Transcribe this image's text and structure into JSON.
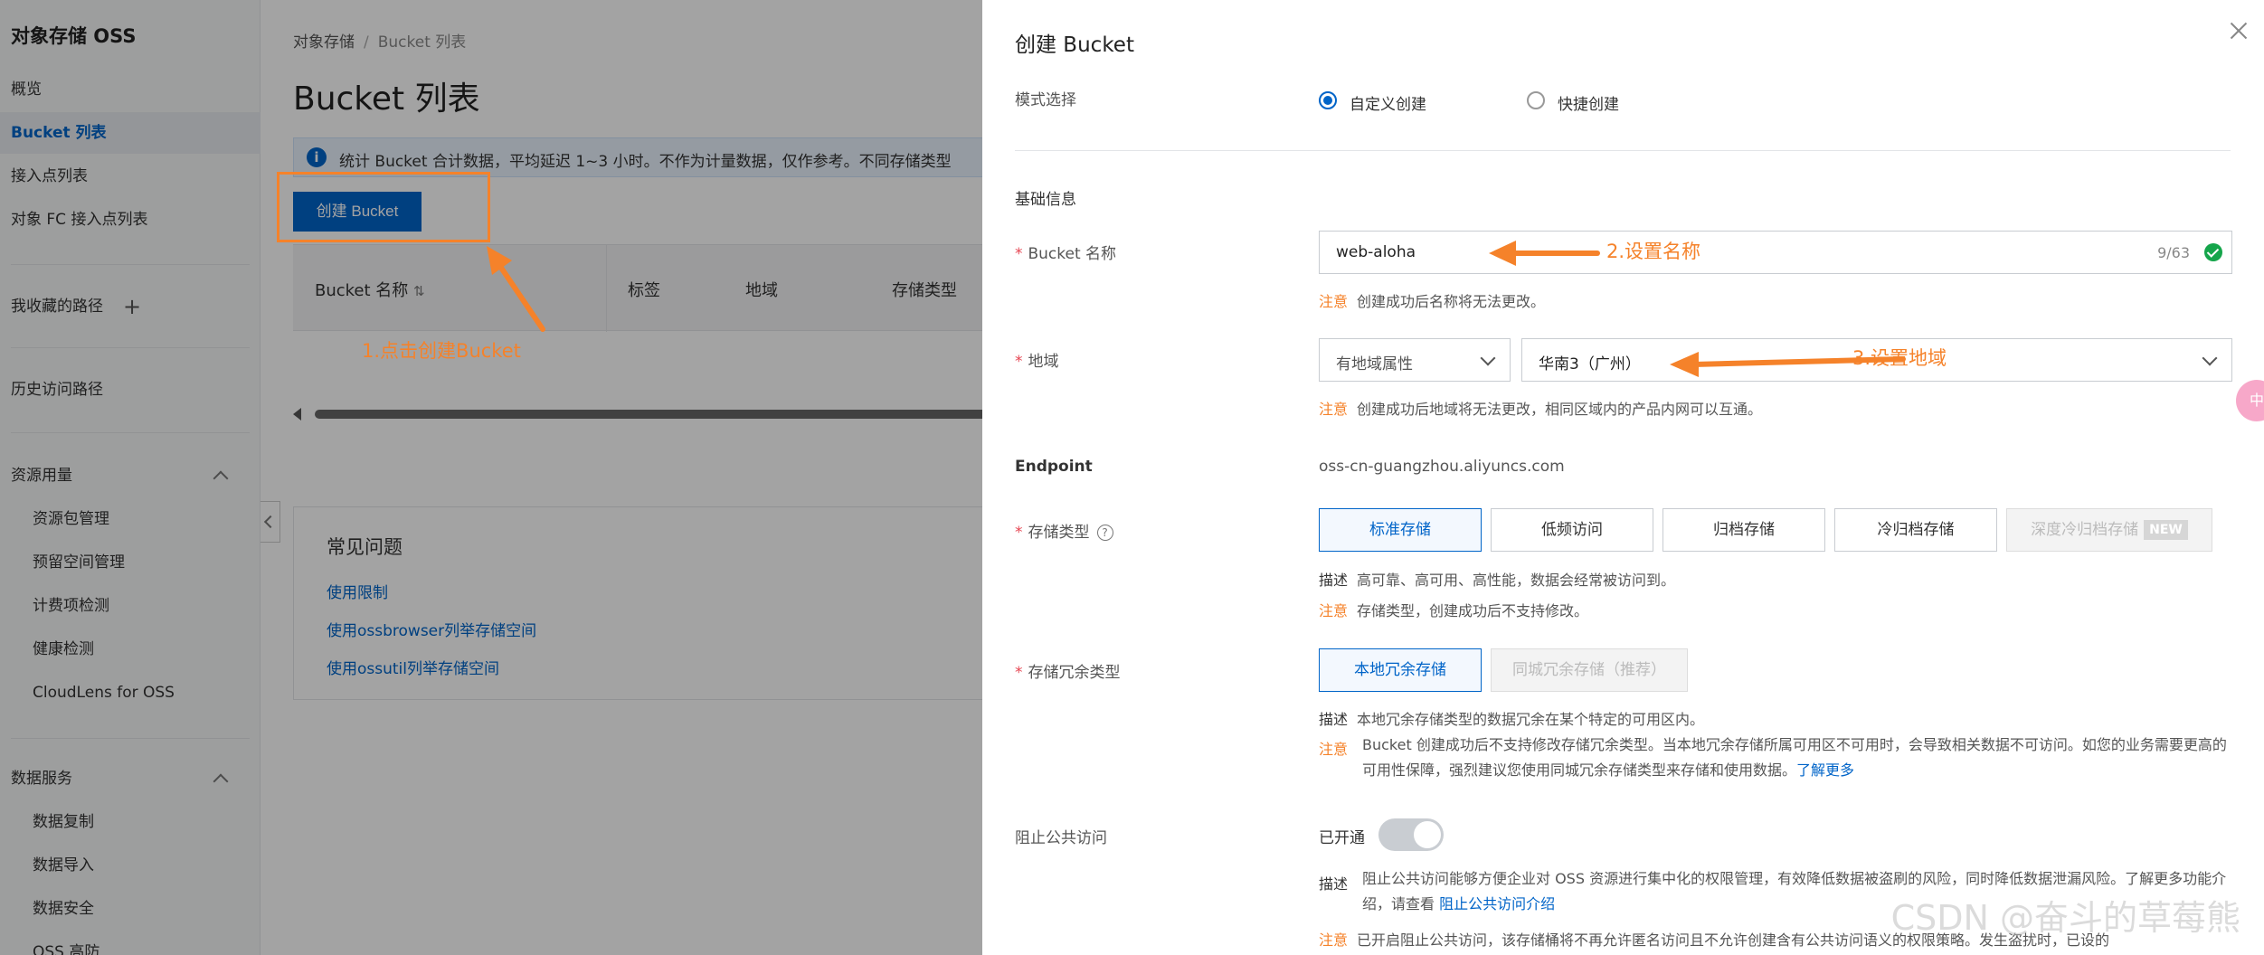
{
  "sidebar": {
    "title": "对象存储 OSS",
    "items": [
      {
        "label": "概览"
      },
      {
        "label": "Bucket 列表"
      },
      {
        "label": "接入点列表"
      },
      {
        "label": "对象 FC 接入点列表"
      }
    ],
    "favorites_label": "我收藏的路径",
    "history_label": "历史访问路径",
    "resource_group": {
      "label": "资源用量",
      "items": [
        "资源包管理",
        "预留空间管理",
        "计费项检测",
        "健康检测",
        "CloudLens for OSS"
      ]
    },
    "data_group": {
      "label": "数据服务",
      "items": [
        "数据复制",
        "数据导入",
        "数据安全",
        "OSS 高防"
      ]
    }
  },
  "main": {
    "breadcrumb": [
      "对象存储",
      "Bucket 列表"
    ],
    "title": "Bucket 列表",
    "info": "统计 Bucket 合计数据，平均延迟 1~3 小时。不作为计量数据，仅作参考。不同存储类型",
    "info_icon": "i",
    "create_button": "创建 Bucket",
    "table_headers": [
      "Bucket 名称",
      "标签",
      "地域",
      "存储类型"
    ],
    "faq": {
      "title": "常见问题",
      "links": [
        "使用限制",
        "使用ossbrowser列举存储空间",
        "使用ossutil列举存储空间"
      ]
    }
  },
  "annotations": {
    "step1": "1.点击创建Bucket",
    "step2": "2.设置名称",
    "step3": "3.设置地域",
    "color": "#f5822a"
  },
  "drawer": {
    "title": "创建 Bucket",
    "mode": {
      "label": "模式选择",
      "options": [
        "自定义创建",
        "快捷创建"
      ],
      "selected": "自定义创建"
    },
    "section_basic": "基础信息",
    "bucket_name": {
      "label": "Bucket 名称",
      "value": "web-aloha",
      "count": "9/63",
      "note_tag": "注意",
      "note": "创建成功后名称将无法更改。"
    },
    "region": {
      "label": "地域",
      "attr_value": "有地域属性",
      "value": "华南3（广州）",
      "note_tag": "注意",
      "note": "创建成功后地域将无法更改，相同区域内的产品内网可以互通。"
    },
    "endpoint": {
      "label": "Endpoint",
      "value": "oss-cn-guangzhou.aliyuncs.com"
    },
    "storage_class": {
      "label": "存储类型",
      "help_icon": "?",
      "options": [
        "标准存储",
        "低频访问",
        "归档存储",
        "冷归档存储",
        "深度冷归档存储"
      ],
      "new_badge": "NEW",
      "selected": "标准存储",
      "desc_tag": "描述",
      "desc": "高可靠、高可用、高性能，数据会经常被访问到。",
      "note_tag": "注意",
      "note": "存储类型，创建成功后不支持修改。"
    },
    "redundancy": {
      "label": "存储冗余类型",
      "options": [
        "本地冗余存储",
        "同城冗余存储（推荐）"
      ],
      "selected": "本地冗余存储",
      "desc_tag": "描述",
      "desc": "本地冗余存储类型的数据冗余在某个特定的可用区内。",
      "note_tag": "注意",
      "note": "Bucket 创建成功后不支持修改存储冗余类型。当本地冗余存储所属可用区不可用时，会导致相关数据不可访问。如您的业务需要更高的可用性保障，强烈建议您使用同城冗余存储类型来存储和使用数据。",
      "link": "了解更多"
    },
    "block_public": {
      "label": "阻止公共访问",
      "state": "已开通",
      "desc_tag": "描述",
      "desc": "阻止公共访问能够方便企业对 OSS 资源进行集中化的权限管理，有效降低数据被盗刷的风险，同时降低数据泄漏风险。了解更多功能介绍，请查看",
      "link": "阻止公共访问介绍",
      "note_tag": "注意",
      "note": "已开启阻止公共访问，该存储桶将不再允许匿名访问且不允许创建含有公共访问语义的权限策略。发生盗扰时，已设的"
    }
  },
  "float_button": "中",
  "watermark": "CSDN @奋斗的草莓熊"
}
